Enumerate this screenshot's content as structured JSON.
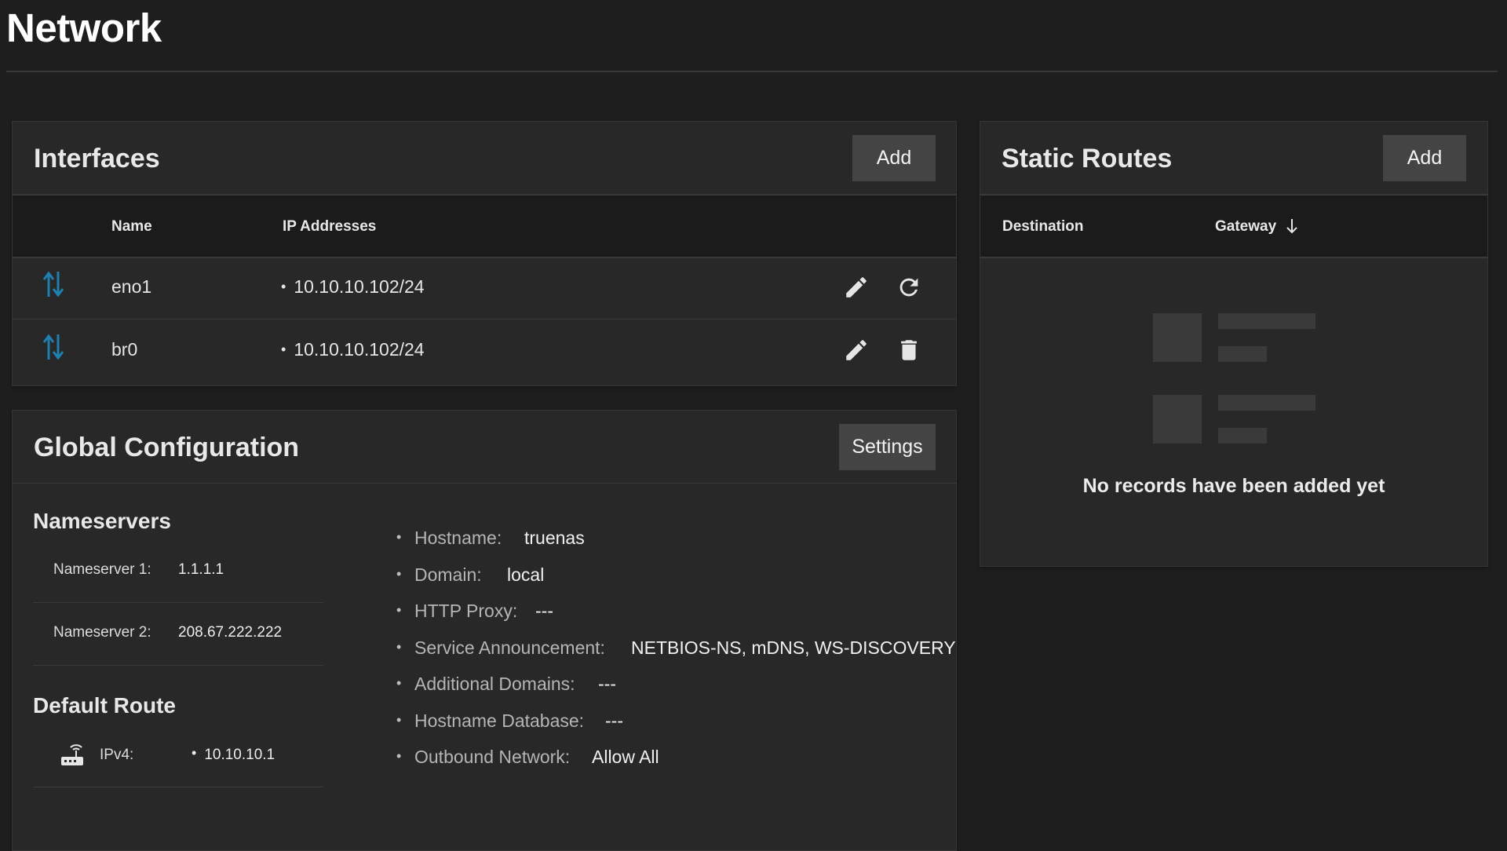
{
  "page": {
    "title": "Network"
  },
  "interfaces": {
    "title": "Interfaces",
    "add_label": "Add",
    "columns": {
      "name": "Name",
      "ip": "IP Addresses"
    },
    "rows": [
      {
        "name": "eno1",
        "ip": "10.10.10.102/24",
        "icon": "arrows-up-down-icon",
        "actions": [
          "edit-icon",
          "reset-icon"
        ]
      },
      {
        "name": "br0",
        "ip": "10.10.10.102/24",
        "icon": "arrows-up-down-icon",
        "actions": [
          "edit-icon",
          "delete-icon"
        ]
      }
    ]
  },
  "global_config": {
    "title": "Global Configuration",
    "settings_label": "Settings",
    "nameservers": {
      "heading": "Nameservers",
      "items": [
        {
          "label": "Nameserver 1:",
          "value": "1.1.1.1"
        },
        {
          "label": "Nameserver 2:",
          "value": "208.67.222.222"
        }
      ]
    },
    "default_route": {
      "heading": "Default Route",
      "label": "IPv4:",
      "value": "10.10.10.1",
      "icon": "router-icon"
    },
    "details": [
      {
        "label": "Hostname:",
        "value": "truenas"
      },
      {
        "label": "Domain:",
        "value": "local"
      },
      {
        "label": "HTTP Proxy:",
        "value": "---"
      },
      {
        "label": "Service Announcement:",
        "value": "NETBIOS-NS, mDNS, WS-DISCOVERY"
      },
      {
        "label": "Additional Domains:",
        "value": "---"
      },
      {
        "label": "Hostname Database:",
        "value": "---"
      },
      {
        "label": "Outbound Network:",
        "value": "Allow All"
      }
    ]
  },
  "static_routes": {
    "title": "Static Routes",
    "add_label": "Add",
    "columns": {
      "destination": "Destination",
      "gateway": "Gateway"
    },
    "empty_text": "No records have been added yet"
  },
  "colors": {
    "background": "#1e1e1e",
    "card": "#282828",
    "button": "#444444",
    "accent_icon": "#1e7fb0"
  }
}
